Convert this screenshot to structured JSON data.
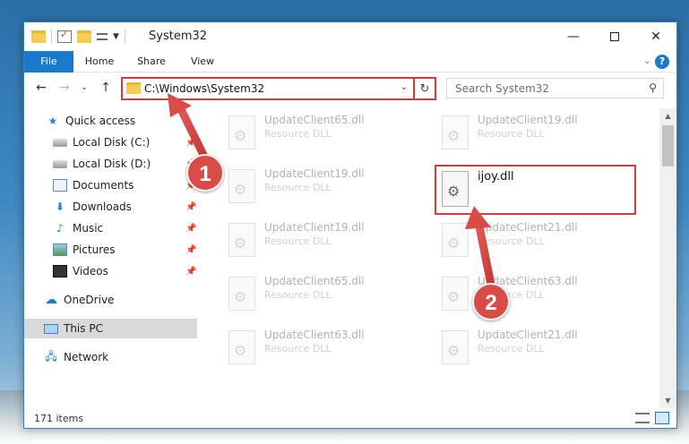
{
  "window": {
    "title": "System32",
    "controls": {
      "minimize": "—",
      "maximize": "",
      "close": "✕"
    }
  },
  "ribbon": {
    "tabs": [
      "File",
      "Home",
      "Share",
      "View"
    ],
    "help": "?",
    "expand": "⌄"
  },
  "nav": {
    "back": "←",
    "forward": "→",
    "recent": "⌄",
    "up": "↑",
    "address": "C:\\Windows\\System32",
    "address_dropdown": "⌄",
    "refresh": "↻",
    "search_placeholder": "Search System32"
  },
  "sidebar": {
    "items": [
      {
        "label": "Quick access",
        "icon": "star-icon",
        "pinned": false
      },
      {
        "label": "Local Disk (C:)",
        "icon": "drive-icon",
        "pinned": true
      },
      {
        "label": "Local Disk (D:)",
        "icon": "drive-icon",
        "pinned": true
      },
      {
        "label": "Documents",
        "icon": "documents-icon",
        "pinned": true
      },
      {
        "label": "Downloads",
        "icon": "download-icon",
        "pinned": true
      },
      {
        "label": "Music",
        "icon": "music-icon",
        "pinned": true
      },
      {
        "label": "Pictures",
        "icon": "pictures-icon",
        "pinned": true
      },
      {
        "label": "Videos",
        "icon": "videos-icon",
        "pinned": true
      },
      {
        "label": "OneDrive",
        "icon": "cloud-icon",
        "pinned": false
      },
      {
        "label": "This PC",
        "icon": "computer-icon",
        "pinned": false,
        "selected": true
      },
      {
        "label": "Network",
        "icon": "network-icon",
        "pinned": false
      }
    ]
  },
  "files": {
    "left_column": [
      {
        "name": "UpdateClient65.dll",
        "type": "Resource DLL"
      },
      {
        "name": "UpdateClient19.dll",
        "type": "Resource DLL"
      },
      {
        "name": "UpdateClient19.dll",
        "type": "Resource DLL"
      },
      {
        "name": "UpdateClient65.dll",
        "type": "Resource DLL"
      },
      {
        "name": "UpdateClient63.dll",
        "type": "Resource DLL"
      }
    ],
    "right_column": [
      {
        "name": "UpdateClient19.dll",
        "type": "Resource DLL"
      },
      {
        "name": "UpdateClient21.dll",
        "type": "Resource DLL"
      },
      {
        "name": "UpdateClient63.dll",
        "type": "Resource DLL"
      },
      {
        "name": "UpdateClient21.dll",
        "type": "Resource DLL"
      }
    ],
    "highlighted": {
      "name": "ijoy.dll"
    }
  },
  "status": {
    "count": "171 items"
  },
  "annotations": {
    "step1": "1",
    "step2": "2"
  },
  "colors": {
    "accent": "#1979ca",
    "highlight": "#d83a3a",
    "badge": "#d84b47"
  }
}
